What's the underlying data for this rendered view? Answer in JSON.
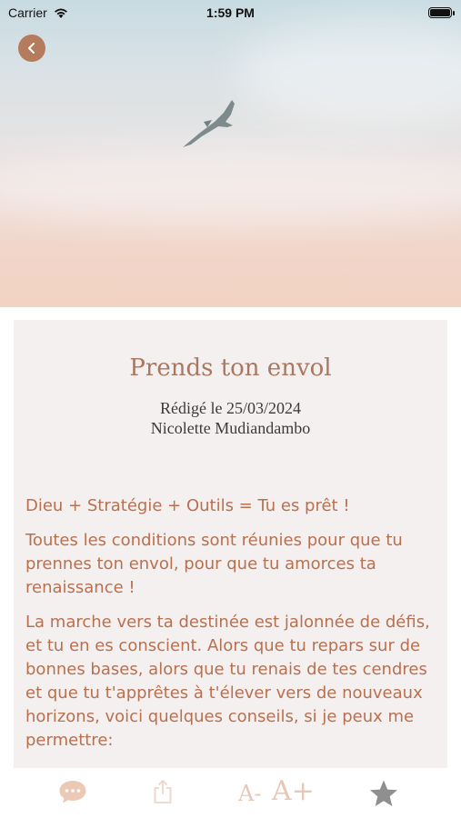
{
  "status": {
    "carrier": "Carrier",
    "time": "1:59 PM"
  },
  "article": {
    "title": "Prends ton envol",
    "date_line": "Rédigé le 25/03/2024",
    "author": "Nicolette Mudiandambo",
    "paragraphs": [
      "Dieu + Stratégie + Outils = Tu es prêt !",
      "Toutes les conditions sont réunies pour que tu prennes ton envol, pour que tu amorces ta renaissance !",
      "La marche vers ta destinée est jalonnée de défis, et tu en es conscient. Alors que tu repars sur de bonnes bases, alors que tu renais de tes cendres et que tu t'apprêtes à t'élever vers de nouveaux horizons, voici quelques conseils, si je peux me permettre:"
    ]
  },
  "toolbar": {
    "font_decrease": "A-",
    "font_increase": "A+",
    "icons": [
      "comment-icon",
      "share-icon",
      "font-decrease-icon",
      "font-increase-icon",
      "star-icon"
    ]
  },
  "colors": {
    "accent": "#b57b5d",
    "body_text": "#b9704f",
    "title": "#a87860",
    "card_bg": "#f4f0ef"
  }
}
